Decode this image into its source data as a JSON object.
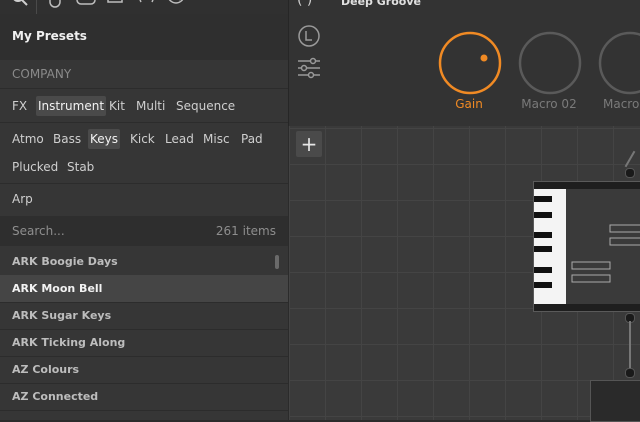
{
  "toolbar": {
    "icons": [
      "search-icon",
      "hand-icon",
      "cloud-icon",
      "square-icon",
      "paren-icon",
      "clock-icon",
      "dropdown-icon"
    ]
  },
  "presets_panel": {
    "title": "My Presets",
    "company_placeholder": "COMPANY",
    "types": [
      "FX",
      "Instrument",
      "Kit",
      "Multi",
      "Sequence"
    ],
    "selected_type": "Instrument",
    "categories_row1": [
      "Atmo",
      "Bass",
      "Keys",
      "Kick",
      "Lead",
      "Misc",
      "Pad"
    ],
    "categories_row2": [
      "Plucked",
      "Stab"
    ],
    "selected_category": "Keys",
    "extra_tag": "Arp",
    "search_placeholder": "Search...",
    "item_count": "261 items",
    "items": [
      "ARK Boogie Days",
      "ARK Moon Bell",
      "ARK Sugar Keys",
      "ARK Ticking Along",
      "AZ Colours",
      "AZ Connected"
    ],
    "selected_item": "ARK Moon Bell"
  },
  "macros": {
    "preset_name": "Deep Groove",
    "knobs": [
      {
        "label": "Gain",
        "active": true,
        "value": 0.55
      },
      {
        "label": "Macro 02",
        "active": false,
        "value": 0
      },
      {
        "label": "Macro",
        "active": false,
        "value": 0
      }
    ],
    "accent": "#f08a24"
  },
  "canvas": {
    "add_label": "+"
  }
}
